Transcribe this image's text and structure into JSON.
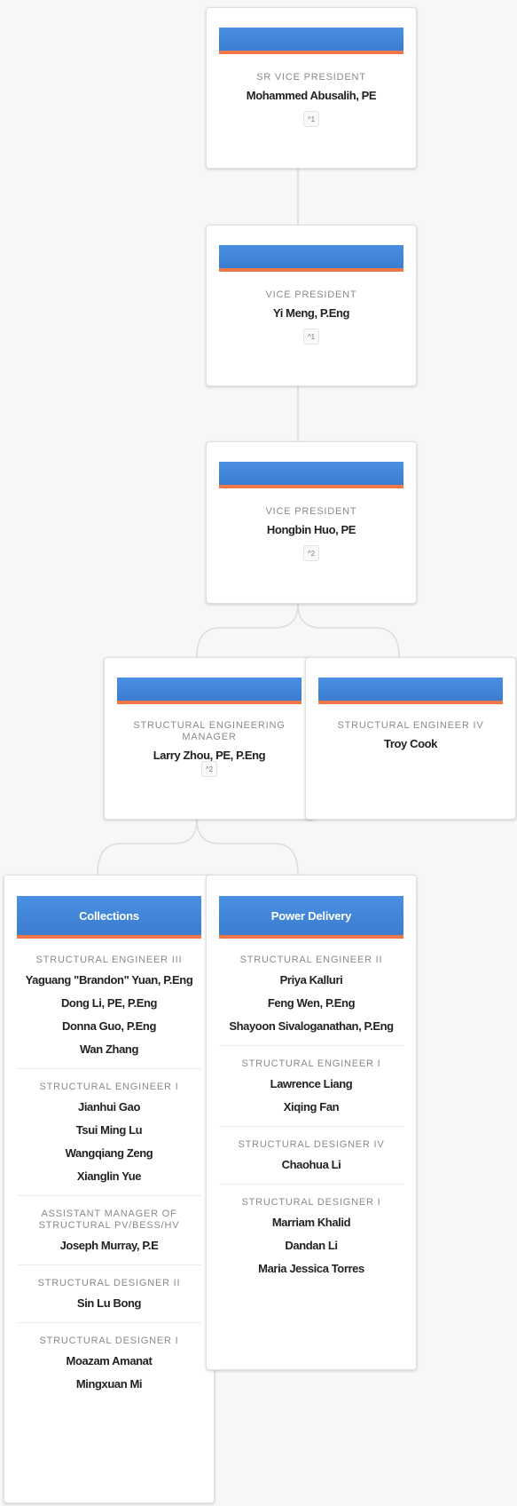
{
  "nodes": {
    "svp": {
      "title": "SR VICE PRESIDENT",
      "name": "Mohammed Abusalih, PE",
      "count": "^1"
    },
    "vp1": {
      "title": "VICE PRESIDENT",
      "name": "Yi Meng, P.Eng",
      "count": "^1"
    },
    "vp2": {
      "title": "VICE PRESIDENT",
      "name": "Hongbin Huo, PE",
      "count": "^2"
    },
    "mgr": {
      "title": "STRUCTURAL ENGINEERING MANAGER",
      "name": "Larry Zhou, PE, P.Eng",
      "count": "^2"
    },
    "troy": {
      "title": "STRUCTURAL ENGINEER IV",
      "name": "Troy Cook"
    }
  },
  "groups": {
    "collections": {
      "header": "Collections",
      "sections": [
        {
          "title": "STRUCTURAL ENGINEER III",
          "members": [
            "Yaguang \"Brandon\" Yuan, P.Eng",
            "Dong Li, PE, P.Eng",
            "Donna Guo, P.Eng",
            "Wan Zhang"
          ]
        },
        {
          "title": "STRUCTURAL ENGINEER I",
          "members": [
            "Jianhui Gao",
            "Tsui Ming Lu",
            "Wangqiang Zeng",
            "Xianglin Yue"
          ]
        },
        {
          "title": "ASSISTANT MANAGER OF STRUCTURAL PV/BESS/HV",
          "members": [
            "Joseph Murray, P.E"
          ]
        },
        {
          "title": "STRUCTURAL DESIGNER II",
          "members": [
            "Sin Lu Bong"
          ]
        },
        {
          "title": "STRUCTURAL DESIGNER I",
          "members": [
            "Moazam Amanat",
            "Mingxuan Mi"
          ]
        }
      ]
    },
    "power": {
      "header": "Power Delivery",
      "sections": [
        {
          "title": "STRUCTURAL ENGINEER II",
          "members": [
            "Priya Kalluri",
            "Feng Wen, P.Eng",
            "Shayoon Sivaloganathan, P.Eng"
          ]
        },
        {
          "title": "STRUCTURAL ENGINEER I",
          "members": [
            "Lawrence Liang",
            "Xiqing Fan"
          ]
        },
        {
          "title": "STRUCTURAL DESIGNER IV",
          "members": [
            "Chaohua Li"
          ]
        },
        {
          "title": "STRUCTURAL DESIGNER I",
          "members": [
            "Marriam Khalid",
            "Dandan Li",
            "Maria Jessica Torres"
          ]
        }
      ]
    }
  },
  "colors": {
    "bar": "#4a90e2",
    "accent": "#f07846"
  }
}
